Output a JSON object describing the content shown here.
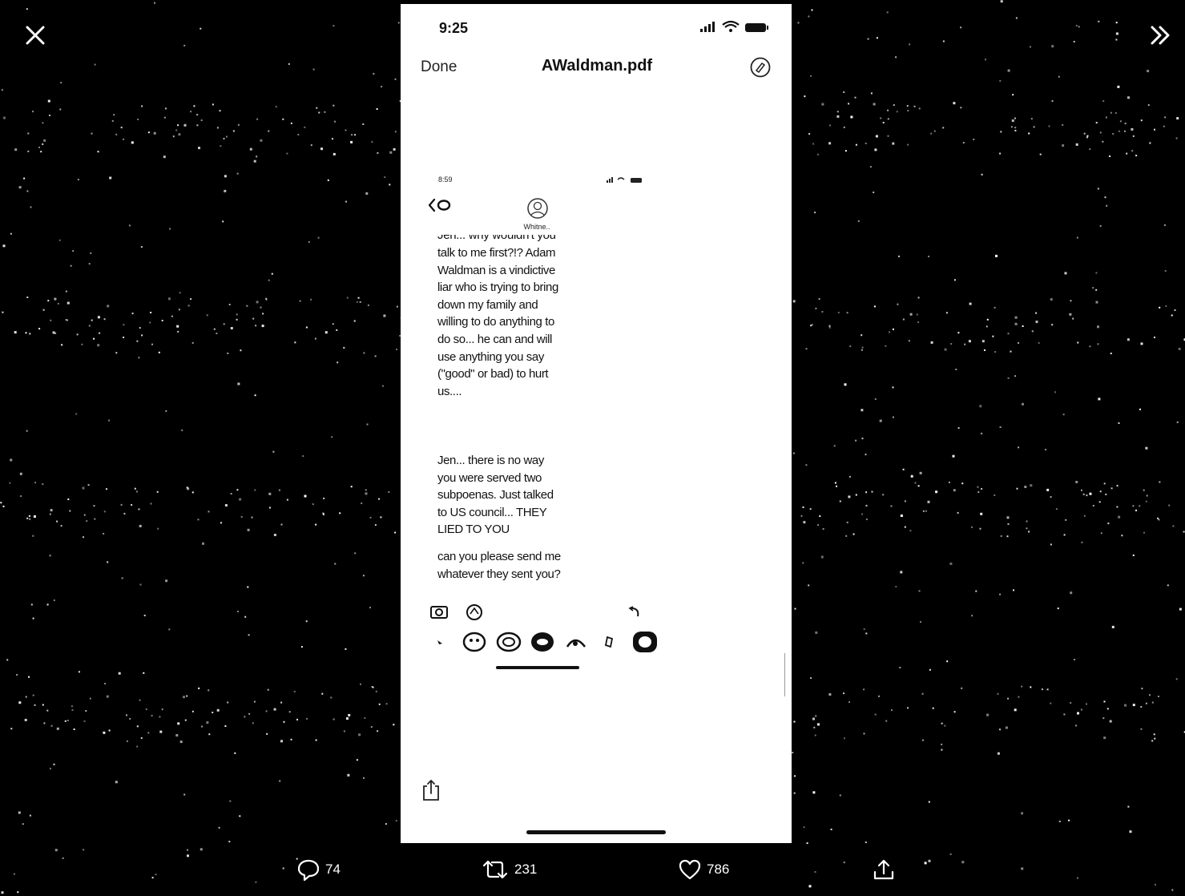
{
  "viewer": {
    "close_icon": "close-icon",
    "expand_icon": "double-chevron-right-icon"
  },
  "phone": {
    "status_time": "9:25",
    "nav": {
      "done_label": "Done",
      "title": "AWaldman.pdf",
      "markup_icon": "markup-pen-icon"
    },
    "inner_screenshot": {
      "status_time": "8:59",
      "contact_name": "Whitne..",
      "messages": [
        {
          "lines": [
            "talk to me first?!? Adam",
            "Waldman is a vindictive",
            "liar who is trying to bring",
            "down my family and",
            "willing to do anything to",
            "do so... he can and will",
            "use anything you say",
            "(\"good\" or bad) to hurt",
            "us...."
          ]
        },
        {
          "lines": [
            "Jen... there is no way",
            "you were served two",
            "subpoenas. Just talked",
            "to US council... THEY",
            "LIED TO YOU"
          ]
        },
        {
          "lines": [
            "can you please send me",
            "whatever they sent you?"
          ]
        }
      ],
      "cut_line": "Jen... why wouldn't you"
    },
    "share_icon": "share-icon"
  },
  "actions": {
    "reply_count": "74",
    "retweet_count": "231",
    "like_count": "786"
  }
}
